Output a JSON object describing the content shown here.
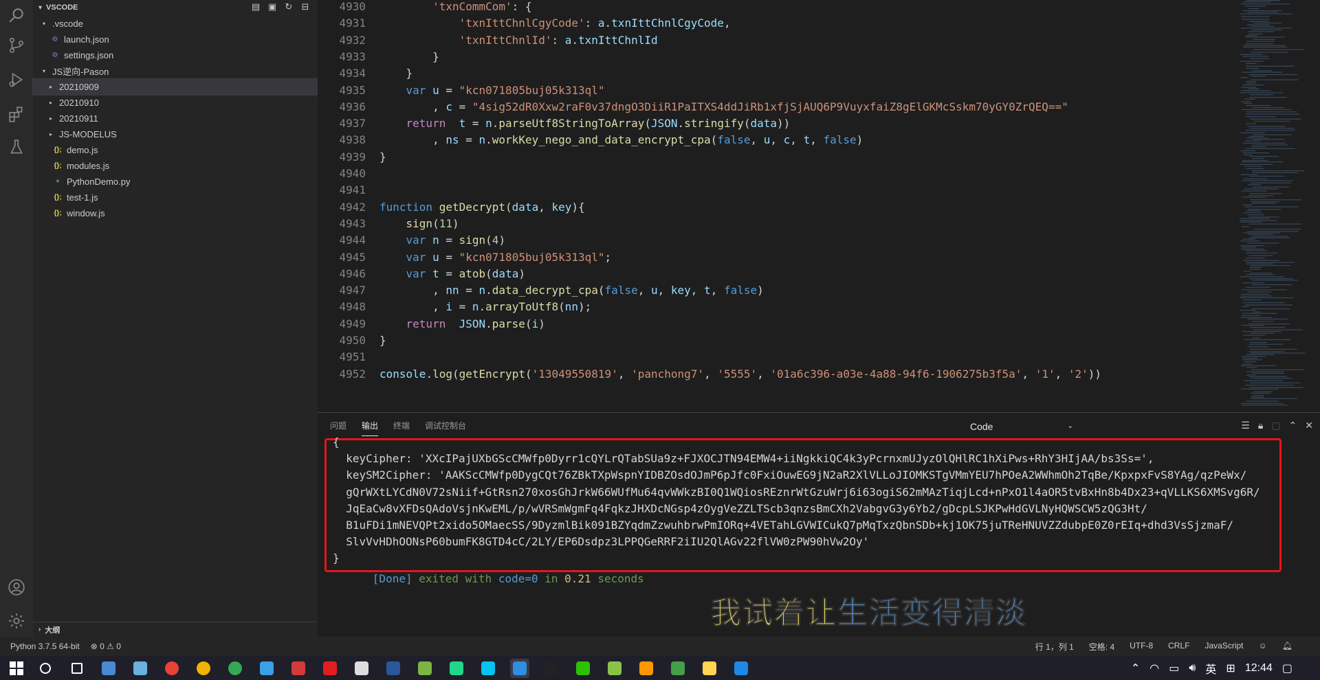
{
  "sidebar": {
    "title": "VSCODE",
    "footer": "大纲",
    "items": [
      {
        "label": ".vscode",
        "indent": 1,
        "tri": "▾",
        "icon": ""
      },
      {
        "label": "launch.json",
        "indent": 2,
        "tri": "",
        "icon": "json"
      },
      {
        "label": "settings.json",
        "indent": 2,
        "tri": "",
        "icon": "json"
      },
      {
        "label": "JS逆向-Pason",
        "indent": 1,
        "tri": "▾",
        "icon": ""
      },
      {
        "label": "20210909",
        "indent": 2,
        "tri": "▸",
        "icon": "",
        "selected": true
      },
      {
        "label": "20210910",
        "indent": 2,
        "tri": "▸",
        "icon": ""
      },
      {
        "label": "20210911",
        "indent": 2,
        "tri": "▸",
        "icon": ""
      },
      {
        "label": "JS-MODELUS",
        "indent": 2,
        "tri": "▸",
        "icon": ""
      },
      {
        "label": "demo.js",
        "indent": 1,
        "tri": "",
        "icon": "js"
      },
      {
        "label": "modules.js",
        "indent": 1,
        "tri": "",
        "icon": "js"
      },
      {
        "label": "PythonDemo.py",
        "indent": 1,
        "tri": "",
        "icon": "py"
      },
      {
        "label": "test-1.js",
        "indent": 1,
        "tri": "",
        "icon": "js"
      },
      {
        "label": "window.js",
        "indent": 1,
        "tri": "",
        "icon": "js"
      }
    ]
  },
  "code": {
    "lines": [
      {
        "n": "4930",
        "parts": [
          [
            "        ",
            "pl"
          ],
          [
            "'txnCommCom'",
            "str"
          ],
          [
            ": {",
            "pl"
          ]
        ]
      },
      {
        "n": "4931",
        "parts": [
          [
            "            ",
            "pl"
          ],
          [
            "'txnIttChnlCgyCode'",
            "str"
          ],
          [
            ": ",
            "pl"
          ],
          [
            "a",
            "id"
          ],
          [
            ".",
            "pl"
          ],
          [
            "txnIttChnlCgyCode",
            "id"
          ],
          [
            ",",
            "pl"
          ]
        ]
      },
      {
        "n": "4932",
        "parts": [
          [
            "            ",
            "pl"
          ],
          [
            "'txnIttChnlId'",
            "str"
          ],
          [
            ": ",
            "pl"
          ],
          [
            "a",
            "id"
          ],
          [
            ".",
            "pl"
          ],
          [
            "txnIttChnlId",
            "id"
          ]
        ]
      },
      {
        "n": "4933",
        "parts": [
          [
            "        }",
            "pl"
          ]
        ]
      },
      {
        "n": "4934",
        "parts": [
          [
            "    }",
            "pl"
          ]
        ]
      },
      {
        "n": "4935",
        "parts": [
          [
            "    ",
            "pl"
          ],
          [
            "var",
            "kw2"
          ],
          [
            " ",
            "pl"
          ],
          [
            "u",
            "id"
          ],
          [
            " = ",
            "pl"
          ],
          [
            "\"kcn071805buj05k313ql\"",
            "str"
          ]
        ]
      },
      {
        "n": "4936",
        "parts": [
          [
            "        , ",
            "pl"
          ],
          [
            "c",
            "id"
          ],
          [
            " = ",
            "pl"
          ],
          [
            "\"4sig52dR0Xxw2raF0v37dngO3DiiR1PaITXS4ddJiRb1xfjSjAUQ6P9VuyxfaiZ8gElGKMcSskm70yGY0ZrQEQ==\"",
            "str"
          ]
        ]
      },
      {
        "n": "4937",
        "parts": [
          [
            "    ",
            "pl"
          ],
          [
            "return",
            "kw"
          ],
          [
            "  ",
            "pl"
          ],
          [
            "t",
            "id"
          ],
          [
            " = ",
            "pl"
          ],
          [
            "n",
            "id"
          ],
          [
            ".",
            "pl"
          ],
          [
            "parseUtf8StringToArray",
            "fn"
          ],
          [
            "(",
            "pl"
          ],
          [
            "JSON",
            "id"
          ],
          [
            ".",
            "pl"
          ],
          [
            "stringify",
            "fn"
          ],
          [
            "(",
            "pl"
          ],
          [
            "data",
            "id"
          ],
          [
            "))",
            "pl"
          ]
        ]
      },
      {
        "n": "4938",
        "parts": [
          [
            "        , ",
            "pl"
          ],
          [
            "ns",
            "id"
          ],
          [
            " = ",
            "pl"
          ],
          [
            "n",
            "id"
          ],
          [
            ".",
            "pl"
          ],
          [
            "workKey_nego_and_data_encrypt_cpa",
            "fn"
          ],
          [
            "(",
            "pl"
          ],
          [
            "false",
            "kw2"
          ],
          [
            ", ",
            "pl"
          ],
          [
            "u",
            "id"
          ],
          [
            ", ",
            "pl"
          ],
          [
            "c",
            "id"
          ],
          [
            ", ",
            "pl"
          ],
          [
            "t",
            "id"
          ],
          [
            ", ",
            "pl"
          ],
          [
            "false",
            "kw2"
          ],
          [
            ")",
            "pl"
          ]
        ]
      },
      {
        "n": "4939",
        "parts": [
          [
            "}",
            "pl"
          ]
        ]
      },
      {
        "n": "4940",
        "parts": []
      },
      {
        "n": "4941",
        "parts": []
      },
      {
        "n": "4942",
        "parts": [
          [
            "function",
            "kw2"
          ],
          [
            " ",
            "pl"
          ],
          [
            "getDecrypt",
            "fn"
          ],
          [
            "(",
            "pl"
          ],
          [
            "data",
            "id"
          ],
          [
            ", ",
            "pl"
          ],
          [
            "key",
            "id"
          ],
          [
            "){",
            "pl"
          ]
        ]
      },
      {
        "n": "4943",
        "parts": [
          [
            "    ",
            "pl"
          ],
          [
            "sign",
            "fn"
          ],
          [
            "(",
            "pl"
          ],
          [
            "11",
            "num"
          ],
          [
            ")",
            "pl"
          ]
        ]
      },
      {
        "n": "4944",
        "parts": [
          [
            "    ",
            "pl"
          ],
          [
            "var",
            "kw2"
          ],
          [
            " ",
            "pl"
          ],
          [
            "n",
            "id"
          ],
          [
            " = ",
            "pl"
          ],
          [
            "sign",
            "fn"
          ],
          [
            "(",
            "pl"
          ],
          [
            "4",
            "num"
          ],
          [
            ")",
            "pl"
          ]
        ]
      },
      {
        "n": "4945",
        "parts": [
          [
            "    ",
            "pl"
          ],
          [
            "var",
            "kw2"
          ],
          [
            " ",
            "pl"
          ],
          [
            "u",
            "id"
          ],
          [
            " = ",
            "pl"
          ],
          [
            "\"kcn071805buj05k313ql\"",
            "str"
          ],
          [
            ";",
            "pl"
          ]
        ]
      },
      {
        "n": "4946",
        "parts": [
          [
            "    ",
            "pl"
          ],
          [
            "var",
            "kw2"
          ],
          [
            " ",
            "pl"
          ],
          [
            "t",
            "id"
          ],
          [
            " = ",
            "pl"
          ],
          [
            "atob",
            "fn"
          ],
          [
            "(",
            "pl"
          ],
          [
            "data",
            "id"
          ],
          [
            ")",
            "pl"
          ]
        ]
      },
      {
        "n": "4947",
        "parts": [
          [
            "        , ",
            "pl"
          ],
          [
            "nn",
            "id"
          ],
          [
            " = ",
            "pl"
          ],
          [
            "n",
            "id"
          ],
          [
            ".",
            "pl"
          ],
          [
            "data_decrypt_cpa",
            "fn"
          ],
          [
            "(",
            "pl"
          ],
          [
            "false",
            "kw2"
          ],
          [
            ", ",
            "pl"
          ],
          [
            "u",
            "id"
          ],
          [
            ", ",
            "pl"
          ],
          [
            "key",
            "id"
          ],
          [
            ", ",
            "pl"
          ],
          [
            "t",
            "id"
          ],
          [
            ", ",
            "pl"
          ],
          [
            "false",
            "kw2"
          ],
          [
            ")",
            "pl"
          ]
        ]
      },
      {
        "n": "4948",
        "parts": [
          [
            "        , ",
            "pl"
          ],
          [
            "i",
            "id"
          ],
          [
            " = ",
            "pl"
          ],
          [
            "n",
            "id"
          ],
          [
            ".",
            "pl"
          ],
          [
            "arrayToUtf8",
            "fn"
          ],
          [
            "(",
            "pl"
          ],
          [
            "nn",
            "id"
          ],
          [
            ");",
            "pl"
          ]
        ]
      },
      {
        "n": "4949",
        "parts": [
          [
            "    ",
            "pl"
          ],
          [
            "return",
            "kw"
          ],
          [
            "  ",
            "pl"
          ],
          [
            "JSON",
            "id"
          ],
          [
            ".",
            "pl"
          ],
          [
            "parse",
            "fn"
          ],
          [
            "(",
            "pl"
          ],
          [
            "i",
            "id"
          ],
          [
            ")",
            "pl"
          ]
        ]
      },
      {
        "n": "4950",
        "parts": [
          [
            "}",
            "pl"
          ]
        ]
      },
      {
        "n": "4951",
        "parts": []
      },
      {
        "n": "4952",
        "parts": [
          [
            "console",
            "id"
          ],
          [
            ".",
            "pl"
          ],
          [
            "log",
            "fn"
          ],
          [
            "(",
            "pl"
          ],
          [
            "getEncrypt",
            "fn"
          ],
          [
            "(",
            "pl"
          ],
          [
            "'13049550819'",
            "str"
          ],
          [
            ", ",
            "pl"
          ],
          [
            "'panchong7'",
            "str"
          ],
          [
            ", ",
            "pl"
          ],
          [
            "'5555'",
            "str"
          ],
          [
            ", ",
            "pl"
          ],
          [
            "'01a6c396-a03e-4a88-94f6-1906275b3f5a'",
            "str"
          ],
          [
            ", ",
            "pl"
          ],
          [
            "'1'",
            "str"
          ],
          [
            ", ",
            "pl"
          ],
          [
            "'2'",
            "str"
          ],
          [
            "))",
            "pl"
          ]
        ]
      }
    ]
  },
  "panel": {
    "tabs": [
      "问题",
      "输出",
      "终端",
      "调试控制台"
    ],
    "active_tab": "输出",
    "dropdown": "Code",
    "output_lines": [
      "{",
      "  keyCipher: 'XXcIPajUXbGScCMWfp0Dyrr1cQYLrQTabSUa9z+FJXOCJTN94EMW4+iiNgkkiQC4k3yPcrnxmUJyzOlQHlRC1hXiPws+RhY3HIjAA/bs3Ss=',",
      "  keySM2Cipher: 'AAKScCMWfp0DygCQt76ZBkTXpWspnYIDBZOsdOJmP6pJfc0FxiOuwEG9jN2aR2XlVLLoJIOMKSTgVMmYEU7hPOeA2WWhmOh2TqBe/KpxpxFvS8YAg/qzPeWx/",
      "  gQrWXtLYCdN0V72sNiif+GtRsn270xosGhJrkW66WUfMu64qvWWkzBI0Q1WQiosREznrWtGzuWrj6i63ogiS62mMAzTiqjLcd+nPxO1l4aOR5tvBxHn8b4Dx23+qVLLKS6XMSvg6R/",
      "  JqEaCw8vXFDsQAdoVsjnKwEML/p/wVRSmWgmFq4FqkzJHXDcNGsp4zOygVeZZLTScb3qnzsBmCXh2VabgvG3y6Yb2/gDcpLSJKPwHdGVLNyHQWSCW5zQG3Ht/",
      "  B1uFDi1mNEVQPt2xido5OMaecSS/9DyzmlBik091BZYqdmZzwuhbrwPmIORq+4VETahLGVWICukQ7pMqTxzQbnSDb+kj1OK75juTReHNUVZZdubpE0Z0rEIq+dhd3VsSjzmaF/",
      "  SlvVvHDhOONsP60bumFK8GTD4cC/2LY/EP6Dsdpz3LPPQGeRRF2iIU2QlAGv22flVW0zPW90hVw2Oy'",
      "}"
    ],
    "done": "[Done]",
    "done_mid": " exited with ",
    "done_code": "code=0",
    "done_in": " in ",
    "done_time": "0.21",
    "done_sec": " seconds"
  },
  "subtitle": {
    "part1": "我试着让",
    "part2": "生活变得清淡"
  },
  "status": {
    "python": "Python 3.7.5 64-bit",
    "problems": "⊗ 0 ⚠ 0",
    "position": "行 1，列 1",
    "spaces": "空格: 4",
    "encoding": "UTF-8",
    "eol": "CRLF",
    "language": "JavaScript"
  },
  "taskbar": {
    "lang": "英",
    "time": "12:44",
    "apps": [
      {
        "name": "search",
        "color": "#ffffff"
      },
      {
        "name": "task-view",
        "color": "#ffffff"
      },
      {
        "name": "computer",
        "color": "#4a8ad4"
      },
      {
        "name": "photos",
        "color": "#6ab0e0"
      },
      {
        "name": "chrome-1",
        "color": "#e94235"
      },
      {
        "name": "chrome-2",
        "color": "#f2b400"
      },
      {
        "name": "chrome-3",
        "color": "#34a853"
      },
      {
        "name": "edge",
        "color": "#3aa0e8"
      },
      {
        "name": "box",
        "color": "#d33b3b"
      },
      {
        "name": "recorder",
        "color": "#e02020"
      },
      {
        "name": "cup",
        "color": "#dddddd"
      },
      {
        "name": "app-blue",
        "color": "#2b579a"
      },
      {
        "name": "android",
        "color": "#7cb342"
      },
      {
        "name": "pycharm",
        "color": "#21d789"
      },
      {
        "name": "webstorm",
        "color": "#07c3f2"
      },
      {
        "name": "vscode",
        "color": "#2f8ee0"
      },
      {
        "name": "qq",
        "color": "#222222"
      },
      {
        "name": "wechat",
        "color": "#2dc100"
      },
      {
        "name": "notepad",
        "color": "#8bc34a"
      },
      {
        "name": "sublime",
        "color": "#ff9800"
      },
      {
        "name": "map",
        "color": "#43a047"
      },
      {
        "name": "files",
        "color": "#ffd54f"
      },
      {
        "name": "js-app",
        "color": "#1e88e5"
      }
    ]
  }
}
